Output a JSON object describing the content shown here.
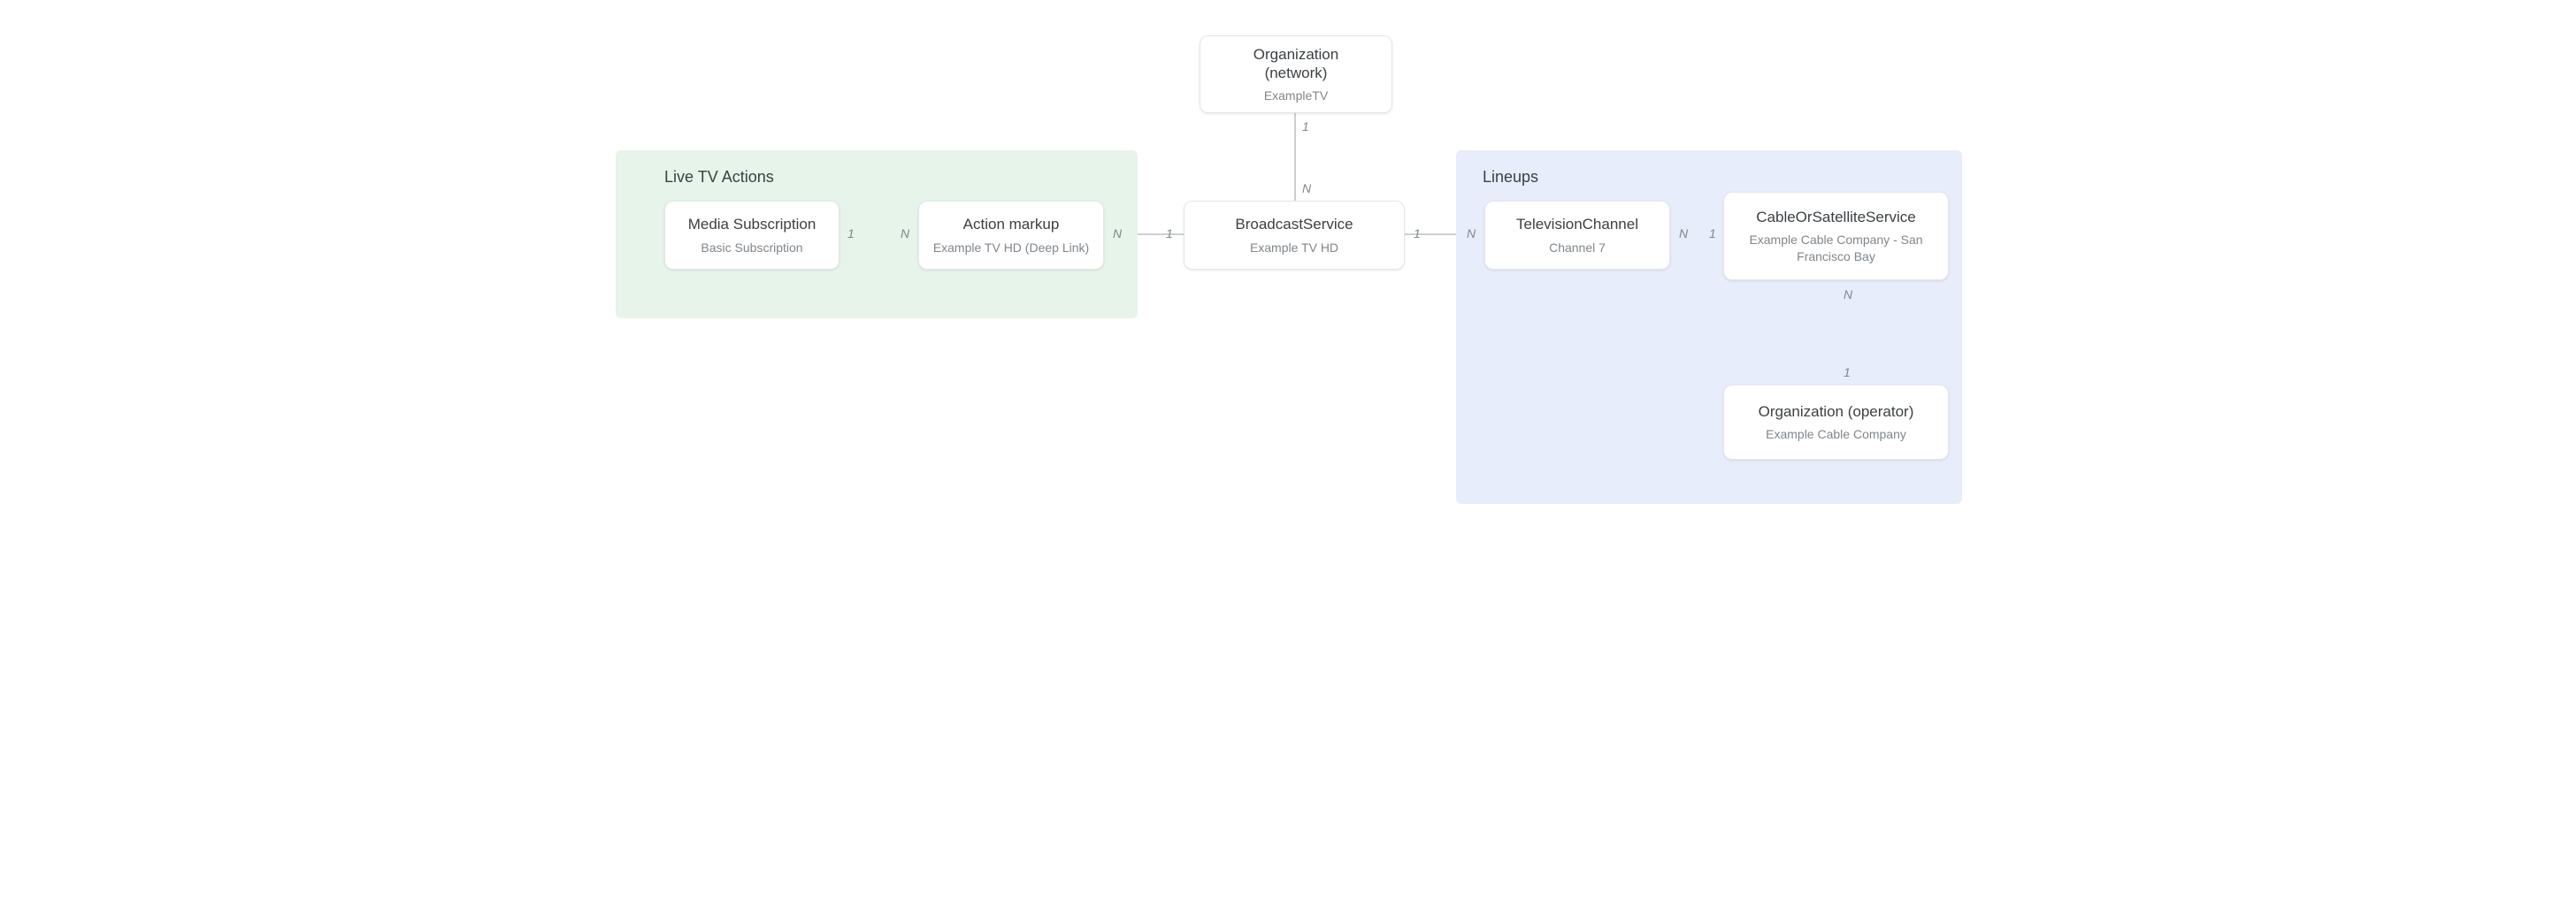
{
  "regions": {
    "liveTv": {
      "title": "Live TV Actions"
    },
    "lineups": {
      "title": "Lineups"
    }
  },
  "nodes": {
    "mediaSubscription": {
      "title": "Media Subscription",
      "sub": "Basic Subscription"
    },
    "actionMarkup": {
      "title": "Action markup",
      "sub": "Example TV HD (Deep Link)"
    },
    "broadcastService": {
      "title": "BroadcastService",
      "sub": "Example TV HD"
    },
    "orgNetwork": {
      "title": "Organization\n(network)",
      "sub": "ExampleTV"
    },
    "tvChannel": {
      "title": "TelevisionChannel",
      "sub": "Channel 7"
    },
    "cableService": {
      "title": "CableOrSatelliteService",
      "sub": "Example Cable Company - San Francisco Bay"
    },
    "orgOperator": {
      "title": "Organization (operator)",
      "sub": "Example Cable Company"
    }
  },
  "labels": {
    "one": "1",
    "many": "N"
  }
}
